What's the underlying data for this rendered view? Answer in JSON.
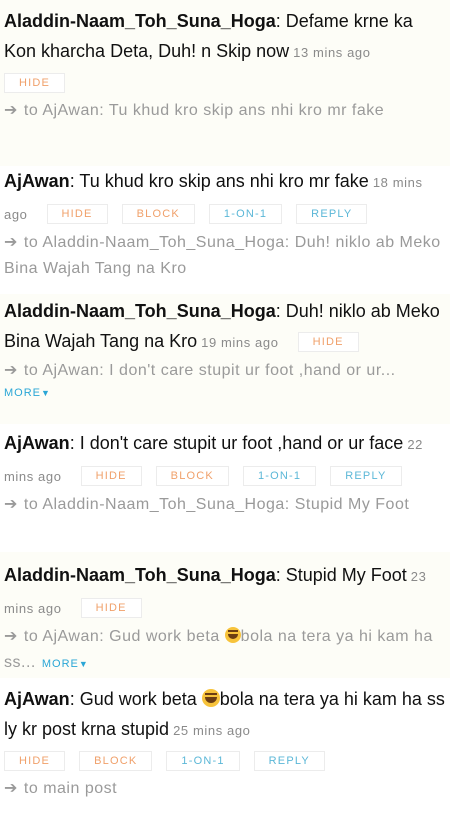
{
  "labels": {
    "hide": "HIDE",
    "block": "BLOCK",
    "one_on_one": "1-ON-1",
    "reply": "REPLY",
    "more": "MORE",
    "more_caret": "▼",
    "arrow": "➔"
  },
  "comments": [
    {
      "author": "Aladdin-Naam_Toh_Suna_Hoga",
      "text": ": Defame krne ka Kon kharcha Deta, Duh! n Skip now",
      "time": "13 mins ago",
      "reply_to": "to AjAwan: Tu khud kro skip ans nhi kro mr fake"
    },
    {
      "author": "AjAwan",
      "text": ": Tu khud kro skip ans nhi kro mr fake",
      "time": "18 mins ago",
      "reply_to": "to Aladdin-Naam_Toh_Suna_Hoga: Duh! niklo ab Meko Bina Wajah Tang na Kro"
    },
    {
      "author": "Aladdin-Naam_Toh_Suna_Hoga",
      "text": ": Duh! niklo ab Meko Bina Wajah Tang na Kro",
      "time": "19 mins ago",
      "reply_to": "to AjAwan: I don't care stupit ur foot ,hand or ur..."
    },
    {
      "author": "AjAwan",
      "text": ": I don't care stupit ur foot ,hand or ur face",
      "time": "22 mins ago",
      "reply_to": "to Aladdin-Naam_Toh_Suna_Hoga: Stupid My Foot"
    },
    {
      "author": "Aladdin-Naam_Toh_Suna_Hoga",
      "text": ": Stupid My Foot",
      "time": "23 mins ago",
      "reply_to_a": "to AjAwan: Gud work beta ",
      "reply_to_b": "bola na tera ya hi kam ha ss..."
    },
    {
      "author": "AjAwan",
      "text_a": ": Gud work beta ",
      "text_b": "bola na tera ya hi kam ha ss ly kr post krna stupid",
      "time": "25 mins ago",
      "reply_to": "to main post"
    }
  ],
  "emoji_name": "laughing-face-icon"
}
